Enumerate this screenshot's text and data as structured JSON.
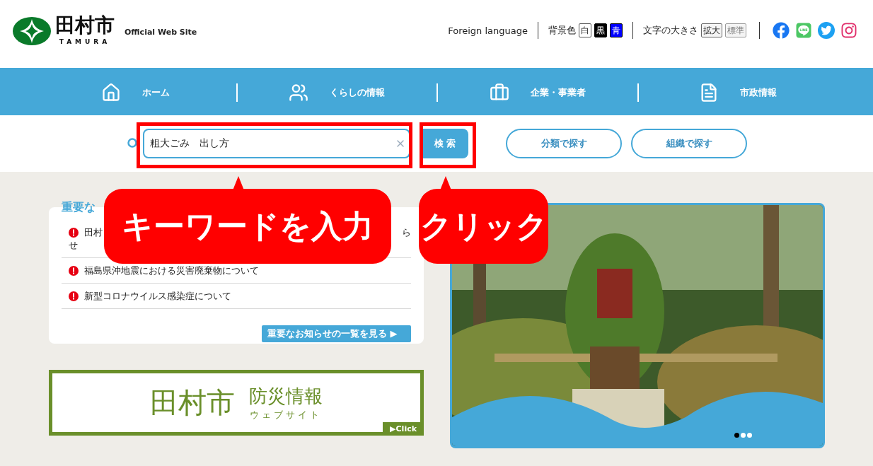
{
  "header": {
    "logo_name": "田村市",
    "logo_roman": "TAMURA",
    "tagline": "Official Web Site",
    "foreign_language": "Foreign language",
    "background_label": "背景色",
    "background_options": [
      {
        "label": "白",
        "kind": "white"
      },
      {
        "label": "黒",
        "kind": "black"
      },
      {
        "label": "青",
        "kind": "blue"
      }
    ],
    "text_size_label": "文字の大きさ",
    "text_size_options": [
      {
        "label": "拡大",
        "kind": "enlarge"
      },
      {
        "label": "標準",
        "kind": "standard"
      }
    ],
    "social": [
      {
        "kind": "facebook"
      },
      {
        "kind": "line"
      },
      {
        "kind": "twitter"
      },
      {
        "kind": "instagram"
      }
    ]
  },
  "nav": [
    {
      "label": "ホーム",
      "kind": "home"
    },
    {
      "label": "くらしの情報",
      "kind": "family"
    },
    {
      "label": "企業・事業者",
      "kind": "business"
    },
    {
      "label": "市政情報",
      "kind": "document"
    }
  ],
  "search": {
    "value": "粗大ごみ　出し方",
    "button": "検 索",
    "category_button": "分類で探す",
    "organization_button": "組織で探す"
  },
  "notices": {
    "heading": "重要な",
    "items": [
      {
        "start": "田村",
        "end": "ら",
        "continuation": "せ"
      },
      {
        "start": "福島県沖地震における災害廃棄物について"
      },
      {
        "start": "新型コロナウイルス感染症について"
      }
    ],
    "more_button": "重要なお知らせの一覧を見る ▶"
  },
  "banner": {
    "city": "田村市",
    "title": "防災情報",
    "subtitle": "ウェブサイト",
    "click": "▶Click"
  },
  "carousel": {
    "kind": "picture",
    "dots": [
      {
        "selected": true
      },
      {
        "selected": false
      },
      {
        "selected": false
      }
    ]
  },
  "callouts": [
    {
      "text": "キーワードを入力"
    },
    {
      "text": "クリック"
    }
  ]
}
